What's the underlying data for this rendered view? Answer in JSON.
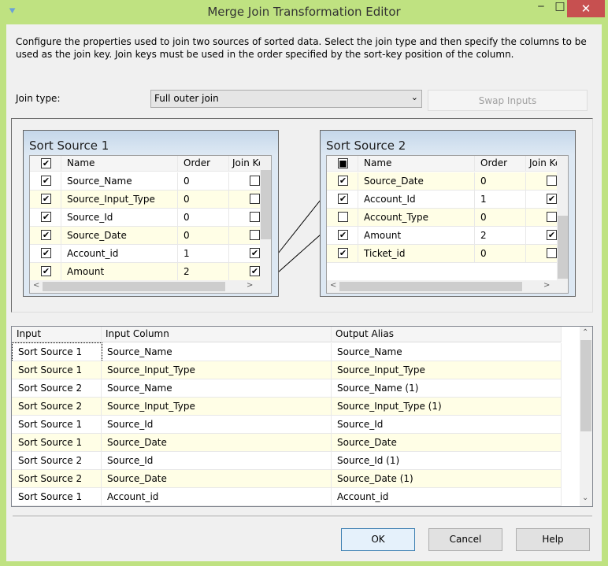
{
  "window": {
    "title": "Merge Join Transformation Editor",
    "minimize": "‒",
    "maximize": "□",
    "close": "✕",
    "app_icon": "merge-join-icon"
  },
  "description": "Configure the properties used to join two sources of sorted data. Select the join type and then specify the columns to be used as the join key. Join keys must be used in the order specified by the sort-key position of the column.",
  "join_type": {
    "label": "Join type:",
    "value": "Full outer join"
  },
  "swap_label": "Swap Inputs",
  "sources": [
    {
      "title": "Sort Source 1",
      "header": {
        "name": "Name",
        "order": "Order",
        "join_key": "Join Key"
      },
      "all_checked": "checked",
      "rows": [
        {
          "checked": true,
          "name": "Source_Name",
          "order": "0",
          "join_key": false
        },
        {
          "checked": true,
          "name": "Source_Input_Type",
          "order": "0",
          "join_key": false
        },
        {
          "checked": true,
          "name": "Source_Id",
          "order": "0",
          "join_key": false
        },
        {
          "checked": true,
          "name": "Source_Date",
          "order": "0",
          "join_key": false
        },
        {
          "checked": true,
          "name": "Account_id",
          "order": "1",
          "join_key": true
        },
        {
          "checked": true,
          "name": "Amount",
          "order": "2",
          "join_key": true
        }
      ]
    },
    {
      "title": "Sort Source 2",
      "header": {
        "name": "Name",
        "order": "Order",
        "join_key": "Join Key"
      },
      "all_checked": "indeterminate",
      "rows": [
        {
          "checked": true,
          "name": "Source_Date",
          "order": "0",
          "join_key": false
        },
        {
          "checked": true,
          "name": "Account_Id",
          "order": "1",
          "join_key": true
        },
        {
          "checked": false,
          "name": "Account_Type",
          "order": "0",
          "join_key": false
        },
        {
          "checked": true,
          "name": "Amount",
          "order": "2",
          "join_key": true
        },
        {
          "checked": true,
          "name": "Ticket_id",
          "order": "0",
          "join_key": false
        }
      ]
    }
  ],
  "output": {
    "columns": [
      "Input",
      "Input Column",
      "Output Alias"
    ],
    "rows": [
      [
        "Sort Source 1",
        "Source_Name",
        "Source_Name"
      ],
      [
        "Sort Source 1",
        "Source_Input_Type",
        "Source_Input_Type"
      ],
      [
        "Sort Source 2",
        "Source_Name",
        "Source_Name (1)"
      ],
      [
        "Sort Source 2",
        "Source_Input_Type",
        "Source_Input_Type (1)"
      ],
      [
        "Sort Source 1",
        "Source_Id",
        "Source_Id"
      ],
      [
        "Sort Source 1",
        "Source_Date",
        "Source_Date"
      ],
      [
        "Sort Source 2",
        "Source_Id",
        "Source_Id (1)"
      ],
      [
        "Sort Source 2",
        "Source_Date",
        "Source_Date (1)"
      ],
      [
        "Sort Source 1",
        "Account_id",
        "Account_id"
      ]
    ]
  },
  "buttons": {
    "ok": "OK",
    "cancel": "Cancel",
    "help": "Help"
  }
}
